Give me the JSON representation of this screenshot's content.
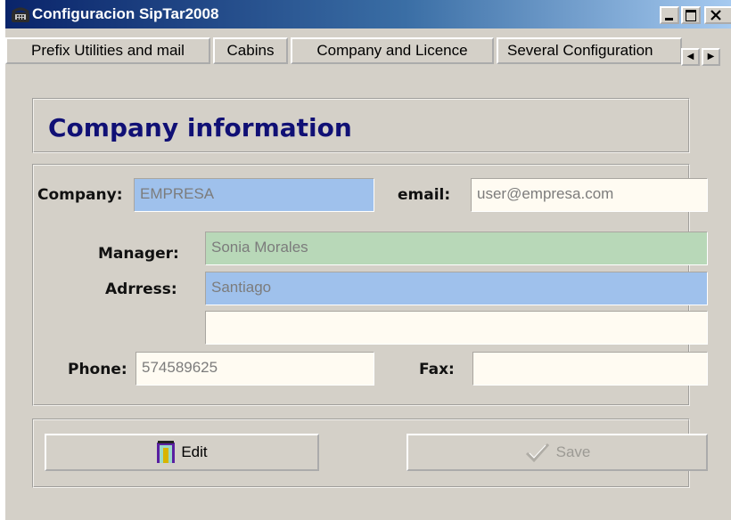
{
  "window": {
    "title": "Configuracion SipTar2008"
  },
  "tabs": [
    {
      "label": "Prefix Utilities and mail"
    },
    {
      "label": "Cabins"
    },
    {
      "label": "Company and Licence"
    },
    {
      "label": "Several Configuration"
    }
  ],
  "section": {
    "heading": "Company information"
  },
  "form": {
    "company": {
      "label": "Company:",
      "value": "EMPRESA"
    },
    "email": {
      "label": "email:",
      "value": "user@empresa.com"
    },
    "manager": {
      "label": "Manager:",
      "value": "Sonia Morales"
    },
    "address": {
      "label": "Adrress:",
      "value": "Santiago",
      "value2": ""
    },
    "phone": {
      "label": "Phone:",
      "value": "574589625"
    },
    "fax": {
      "label": "Fax:",
      "value": ""
    }
  },
  "buttons": {
    "edit": "Edit",
    "save": "Save"
  },
  "icons": [
    "app-icon",
    "minimize-icon",
    "maximize-icon",
    "close-icon",
    "tab-scroll-left-icon",
    "tab-scroll-right-icon",
    "door-icon",
    "checkmark-icon"
  ]
}
